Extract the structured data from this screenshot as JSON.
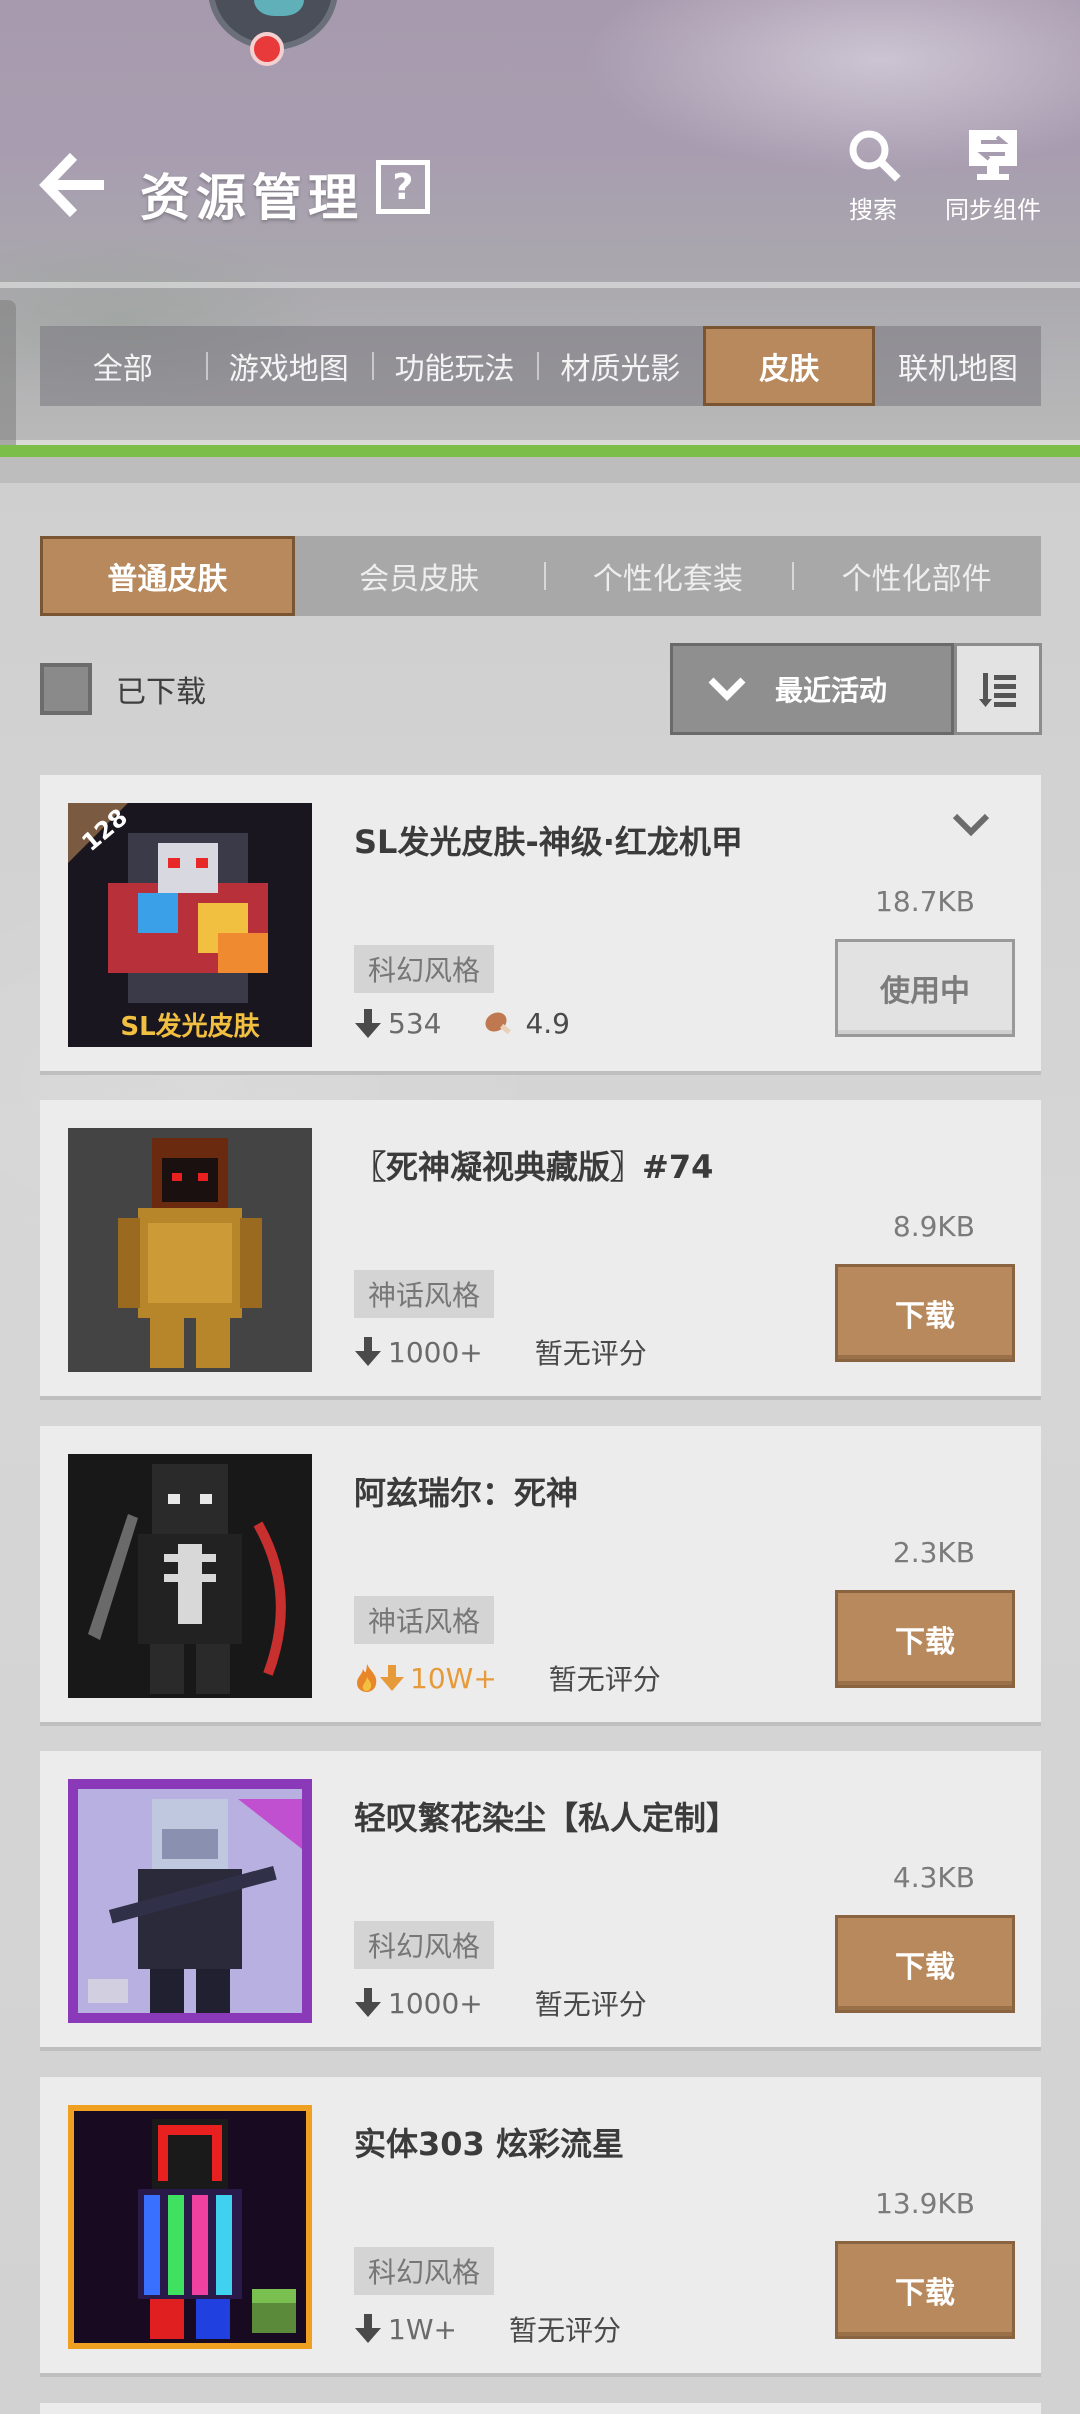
{
  "header": {
    "title": "资源管理",
    "help_label": "?",
    "search_label": "搜索",
    "sync_label": "同步组件"
  },
  "main_tabs": [
    {
      "label": "全部",
      "active": false
    },
    {
      "label": "游戏地图",
      "active": false
    },
    {
      "label": "功能玩法",
      "active": false
    },
    {
      "label": "材质光影",
      "active": false
    },
    {
      "label": "皮肤",
      "active": true
    },
    {
      "label": "联机地图",
      "active": false
    }
  ],
  "sub_tabs": [
    {
      "label": "普通皮肤",
      "active": true
    },
    {
      "label": "会员皮肤",
      "active": false
    },
    {
      "label": "个性化套装",
      "active": false
    },
    {
      "label": "个性化部件",
      "active": false
    }
  ],
  "filter": {
    "downloaded_label": "已下载",
    "sort_label": "最近活动"
  },
  "items": [
    {
      "title": "SL发光皮肤-神级·红龙机甲",
      "size": "18.7KB",
      "style": "科幻风格",
      "downloads": "534",
      "rating": "4.9",
      "action": "使用中",
      "badge": "128",
      "banner": "SL发光皮肤"
    },
    {
      "title": "〖死神凝视典藏版〗#74",
      "size": "8.9KB",
      "style": "神话风格",
      "downloads": "1000+",
      "rating": "暂无评分",
      "action": "下载"
    },
    {
      "title": "阿兹瑞尔：死神",
      "size": "2.3KB",
      "style": "神话风格",
      "downloads": "10W+",
      "rating": "暂无评分",
      "action": "下载"
    },
    {
      "title": "轻叹繁花染尘【私人定制】",
      "size": "4.3KB",
      "style": "科幻风格",
      "downloads": "1000+",
      "rating": "暂无评分",
      "action": "下载"
    },
    {
      "title": "实体303 炫彩流星",
      "size": "13.9KB",
      "style": "科幻风格",
      "downloads": "1W+",
      "rating": "暂无评分",
      "action": "下载"
    }
  ],
  "colors": {
    "accent": "#b8895c",
    "accent_border": "#7a5534",
    "green_strip": "#7bbf4a",
    "hot": "#e69a3a"
  }
}
